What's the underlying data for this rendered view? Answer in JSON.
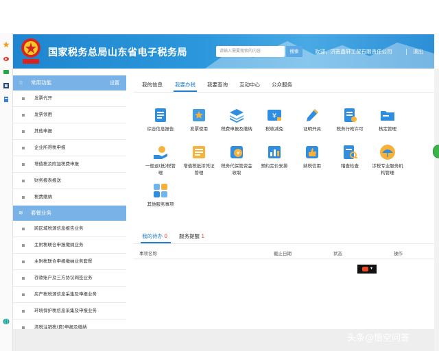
{
  "header": {
    "title": "国家税务总局山东省电子税务局",
    "search_placeholder": "请输入需要搜索的内容",
    "search_button": "搜索",
    "welcome": "欢迎，济南鑫轩工贸有限责任公司",
    "logout": "退出",
    "emblem_text": "中国税务"
  },
  "sidebar": {
    "section1": {
      "label": "常用功能",
      "settings": "设置"
    },
    "items1": [
      "发票代开",
      "发票领用",
      "其他申报",
      "企业所得税申报",
      "增值税及附加税费申报",
      "财务报表报送",
      "税费缴纳"
    ],
    "section2": {
      "label": "套餐业务"
    },
    "items2": [
      "跨区域税源信息报告业务",
      "主附税联合申报缴纳业务",
      "主附税联合申报缴纳业务套餐",
      "存款账户及三方协议网签业务",
      "房产税税源信息采集及申报业务",
      "环境保护税信息采集及申报业务",
      "清税注销税(费)申报及缴纳"
    ]
  },
  "main": {
    "tabs": [
      "我的信息",
      "我要办税",
      "我要查询",
      "互动中心",
      "公众服务"
    ],
    "active_tab": "我要办税",
    "services": [
      {
        "label": "综合信息报告",
        "icon": "report-doc-icon"
      },
      {
        "label": "发票使用",
        "icon": "invoice-star-icon"
      },
      {
        "label": "税费申报及缴纳",
        "icon": "layers-stack-icon"
      },
      {
        "label": "税收减免",
        "icon": "yen-tag-icon"
      },
      {
        "label": "证明开具",
        "icon": "pen-icon"
      },
      {
        "label": "税务行政许可",
        "icon": "license-doc-icon"
      },
      {
        "label": "核定管理",
        "icon": "folder-icon"
      },
      {
        "label": "一般退(抵)税管理",
        "icon": "refund-hand-icon"
      },
      {
        "label": "增值税抵扣凭证管理",
        "icon": "voucher-icon"
      },
      {
        "label": "税务代保管资金收取",
        "icon": "money-bag-icon"
      },
      {
        "label": "预约定价安排",
        "icon": "bar-chart-icon"
      },
      {
        "label": "纳税信用",
        "icon": "thumb-up-icon"
      },
      {
        "label": "稽查检查",
        "icon": "inspect-doc-icon"
      },
      {
        "label": "涉税专业服务机构管理",
        "icon": "umbrella-icon"
      },
      {
        "label": "其他服务事项",
        "icon": "grid-apps-icon"
      }
    ]
  },
  "todo": {
    "tab1_label": "我的待办",
    "tab1_count": "0",
    "tab2_label": "服务提醒",
    "tab2_count": "1",
    "columns": [
      "事项名称",
      "截止日期",
      "状态",
      "操作"
    ]
  },
  "watermark": "头条@悟空问答",
  "colors": {
    "header_blue": "#2c97dc",
    "accent": "#1e7ed0",
    "sidebar_head": "#78b2e6",
    "count_red": "#e04a3a"
  }
}
